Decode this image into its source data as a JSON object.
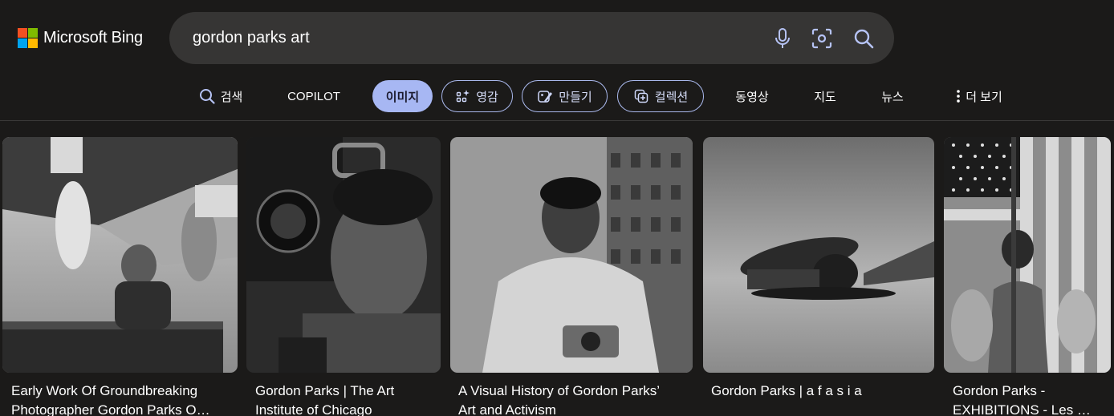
{
  "brand": {
    "name": "Microsoft Bing"
  },
  "search": {
    "query": "gordon parks art"
  },
  "nav": {
    "search": "검색",
    "copilot": "COPILOT",
    "images": "이미지",
    "inspiration": "영감",
    "create": "만들기",
    "collections": "컬렉션",
    "videos": "동영상",
    "maps": "지도",
    "news": "뉴스",
    "more": "더 보기"
  },
  "results": [
    {
      "caption_line1": "Early Work Of Groundbreaking",
      "caption_line2": "Photographer Gordon Parks O…"
    },
    {
      "caption_line1": "Gordon Parks | The Art",
      "caption_line2": "Institute of Chicago"
    },
    {
      "caption_line1": "A Visual History of Gordon Parks’",
      "caption_line2": "Art and Activism"
    },
    {
      "caption_line1": "Gordon Parks | a f a s i a",
      "caption_line2": ""
    },
    {
      "caption_line1": "Gordon Parks -",
      "caption_line2": "EXHIBITIONS - Les …"
    }
  ],
  "colors": {
    "background": "#1b1a19",
    "searchbox": "#363534",
    "active_tab": "#a7b7f3",
    "pill_border": "#a9b8ec"
  },
  "icons": [
    "microphone-icon",
    "visual-search-icon",
    "search-icon",
    "image-inspiration-icon",
    "create-image-icon",
    "collections-icon",
    "more-vertical-icon"
  ]
}
